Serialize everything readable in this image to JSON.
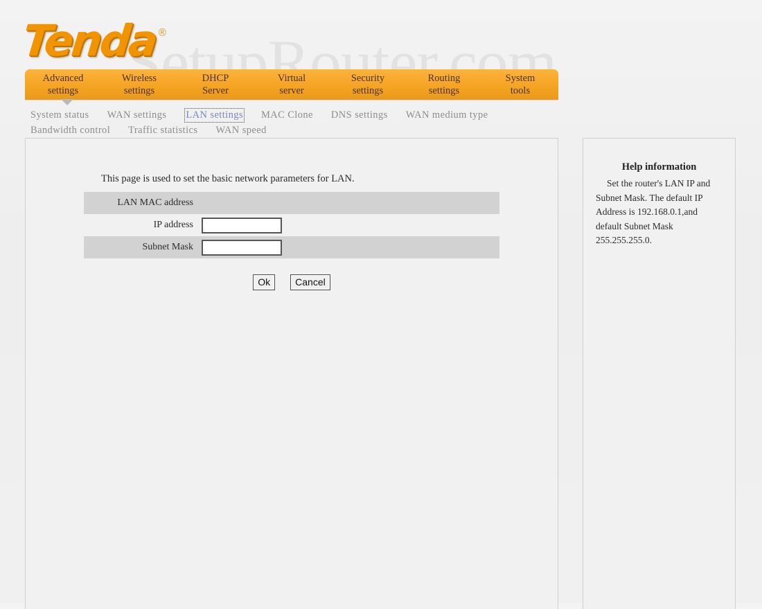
{
  "brand": {
    "logo_text": "Tenda",
    "trademark_symbol": "®"
  },
  "watermark": {
    "text": "SetupRouter.com"
  },
  "main_tabs": [
    {
      "line1": "Advanced",
      "line2": "settings",
      "active": true
    },
    {
      "line1": "Wireless",
      "line2": "settings",
      "active": false
    },
    {
      "line1": "DHCP",
      "line2": "Server",
      "active": false
    },
    {
      "line1": "Virtual",
      "line2": "server",
      "active": false
    },
    {
      "line1": "Security",
      "line2": "settings",
      "active": false
    },
    {
      "line1": "Routing",
      "line2": "settings",
      "active": false
    },
    {
      "line1": "System",
      "line2": "tools",
      "active": false
    }
  ],
  "sub_nav": {
    "row1": [
      {
        "label": "System status",
        "active": false
      },
      {
        "label": "WAN settings",
        "active": false
      },
      {
        "label": "LAN settings",
        "active": true
      },
      {
        "label": "MAC Clone",
        "active": false
      },
      {
        "label": "DNS settings",
        "active": false
      },
      {
        "label": "WAN medium type",
        "active": false
      }
    ],
    "row2": [
      {
        "label": "Bandwidth control",
        "active": false
      },
      {
        "label": "Traffic statistics",
        "active": false
      },
      {
        "label": "WAN speed",
        "active": false
      }
    ]
  },
  "form": {
    "intro": "This page is used to set the basic network parameters for LAN.",
    "rows": [
      {
        "label": "LAN MAC address",
        "value": "",
        "type": "text"
      },
      {
        "label": "IP address",
        "value": "",
        "placeholder": "",
        "type": "input"
      },
      {
        "label": "Subnet Mask",
        "value": "",
        "placeholder": "",
        "type": "input"
      }
    ],
    "ok_label": "Ok",
    "cancel_label": "Cancel"
  },
  "help": {
    "title": "Help information",
    "body": "Set the router's LAN IP and Subnet Mask. The default IP Address is 192.168.0.1,and default Subnet Mask 255.255.255.0."
  },
  "colors": {
    "brand_orange": "#f29400",
    "tab_bar": "#f8a92c",
    "active_link": "#7a87bb",
    "row_shade": "#d2d2d2",
    "panel_bg": "#f1f1f1"
  }
}
